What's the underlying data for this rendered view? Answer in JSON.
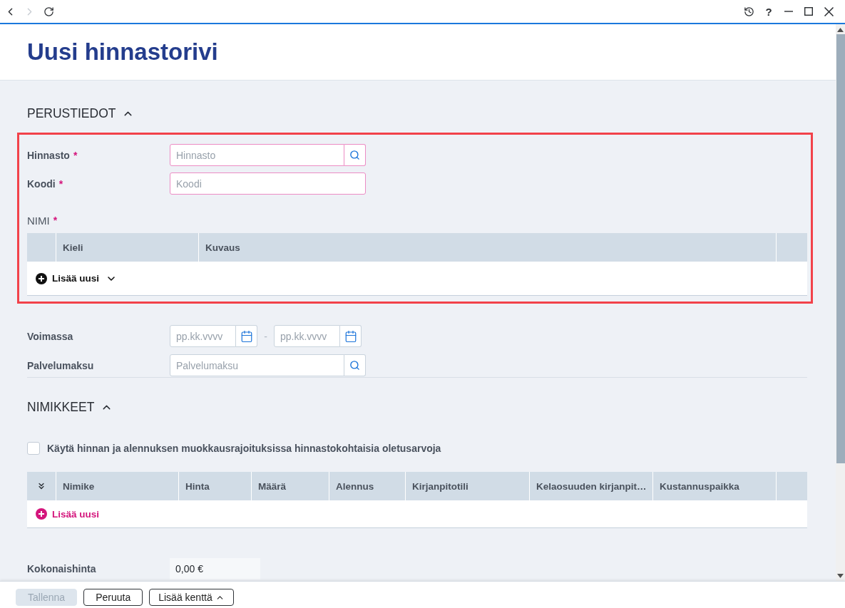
{
  "nav_buttons": [
    {
      "kind": "back",
      "disabled": false
    },
    {
      "kind": "forward",
      "disabled": true
    },
    {
      "kind": "reload",
      "disabled": false
    }
  ],
  "window_controls": [
    {
      "kind": "history"
    },
    {
      "kind": "help",
      "label": "?"
    },
    {
      "kind": "minimize"
    },
    {
      "kind": "maximize"
    },
    {
      "kind": "close"
    }
  ],
  "page": {
    "title": "Uusi hinnastorivi"
  },
  "basic_info": {
    "title": "PERUSTIEDOT",
    "expanded": true,
    "highlighted": true,
    "fields": [
      {
        "kind": "lookup",
        "label": "Hinnasto",
        "required_mark": "*",
        "placeholder": "Hinnasto",
        "invalid": true
      },
      {
        "kind": "text",
        "label": "Koodi",
        "required_mark": "*",
        "placeholder": "Koodi",
        "invalid": true
      }
    ],
    "name_table": {
      "label": "NIMI",
      "required_mark": "*",
      "columns": [
        "Kieli",
        "Kuvaus"
      ],
      "add_button": {
        "kind": "dropdown",
        "label": "Lisää uusi"
      }
    },
    "more_fields": [
      {
        "kind": "date_range",
        "label": "Voimassa",
        "start_placeholder": "pp.kk.vvvv",
        "separator": "-",
        "end_placeholder": "pp.kk.vvvv",
        "invalid": false
      },
      {
        "kind": "lookup",
        "label": "Palvelumaksu",
        "placeholder": "Palvelumaksu",
        "invalid": false
      }
    ]
  },
  "items": {
    "title": "NIMIKKEET",
    "expanded": true,
    "checkbox": {
      "label": "Käytä hinnan ja alennuksen muokkausrajoituksissa hinnastokohtaisia oletusarvoja",
      "checked": false
    },
    "table": {
      "columns": [
        "Nimike",
        "Hinta",
        "Määrä",
        "Alennus",
        "Kirjanpitotili",
        "Kelaosuuden kirjanpit…",
        "Kustannuspaikka"
      ],
      "add_button": {
        "kind": "link",
        "label": "Lisää uusi"
      }
    },
    "total": {
      "label": "Kokonaishinta",
      "value": "0,00 €"
    }
  },
  "footer_buttons": [
    {
      "kind": "primary",
      "label": "Tallenna",
      "disabled": true
    },
    {
      "kind": "secondary",
      "label": "Peruuta",
      "disabled": false
    },
    {
      "kind": "menu",
      "label": "Lisää kenttä",
      "disabled": false
    }
  ]
}
